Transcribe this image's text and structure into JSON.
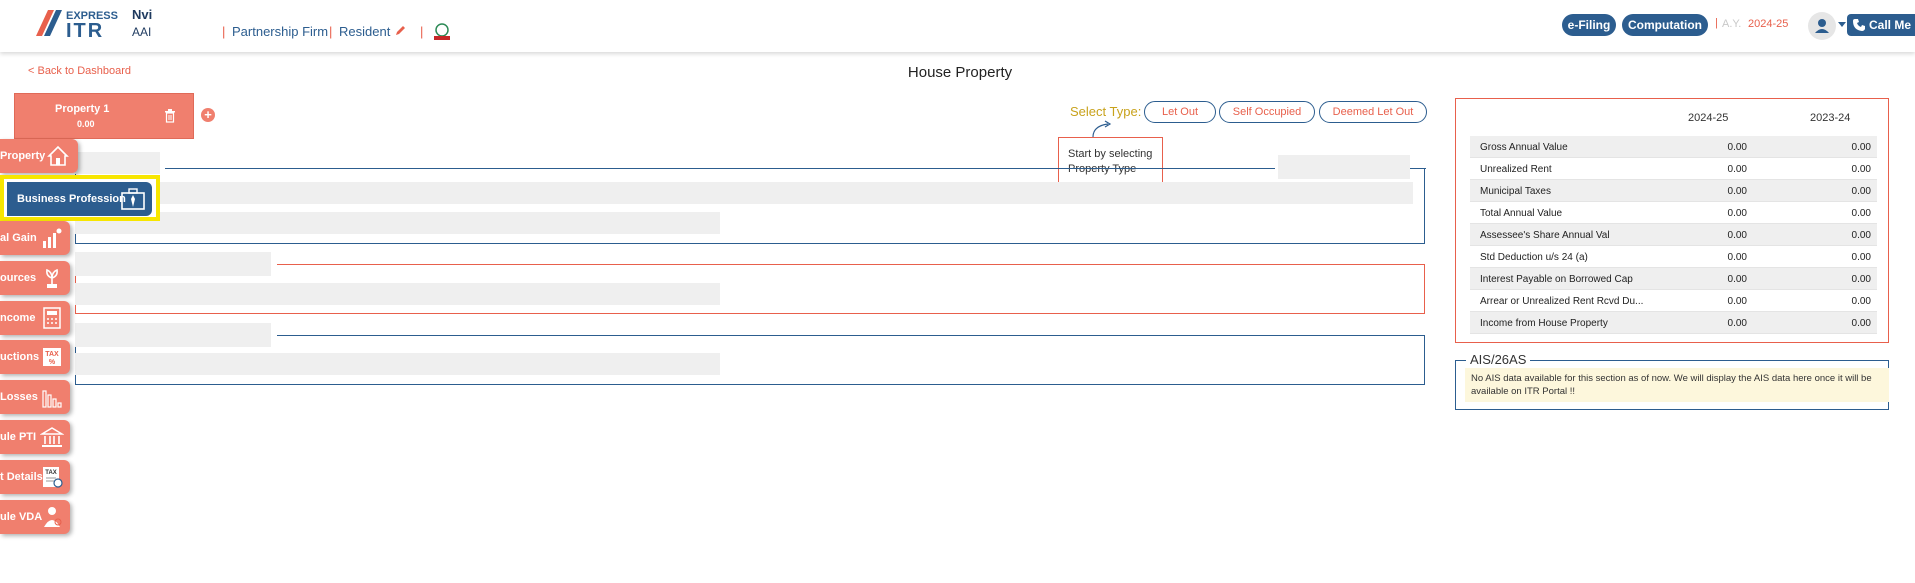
{
  "header": {
    "logo_top": "EXPRESS",
    "logo_main": "ITR",
    "user_name": "Nvi",
    "user_pan": "AAI",
    "status_type": "Partnership Firm",
    "residency": "Resident",
    "efiling_label": "e-Filing",
    "computation_label": "Computation",
    "ay_label": "A.Y.",
    "ay_value": "2024-25",
    "callme_label": "Call Me"
  },
  "nav": {
    "back_label": "< Back to Dashboard",
    "page_title": "House Property"
  },
  "property_tab": {
    "name": "Property 1",
    "amount": "0.00",
    "add_label": "+"
  },
  "type_selector": {
    "label": "Select Type:",
    "options": [
      "Let Out",
      "Self Occupied",
      "Deemed Let Out"
    ],
    "tooltip": "Start by selecting Property Type"
  },
  "sidebar": {
    "items": [
      {
        "label": "Property",
        "icon": "house-icon"
      },
      {
        "label": "Business Profession",
        "icon": "briefcase-icon",
        "highlighted": true
      },
      {
        "label": "al Gain",
        "icon": "chart-growth-icon"
      },
      {
        "label": "ources",
        "icon": "plant-icon"
      },
      {
        "label": "ncome",
        "icon": "calculator-icon"
      },
      {
        "label": "uctions",
        "icon": "tax-percent-icon"
      },
      {
        "label": "Losses",
        "icon": "loss-chart-icon"
      },
      {
        "label": "ule PTI",
        "icon": "bank-icon"
      },
      {
        "label": "t Details",
        "icon": "tax-doc-icon"
      },
      {
        "label": "ule VDA",
        "icon": "crypto-user-icon"
      }
    ]
  },
  "summary": {
    "years": [
      "2024-25",
      "2023-24"
    ],
    "rows": [
      {
        "name": "Gross Annual Value",
        "v1": "0.00",
        "v2": "0.00"
      },
      {
        "name": "Unrealized Rent",
        "v1": "0.00",
        "v2": "0.00"
      },
      {
        "name": "Municipal Taxes",
        "v1": "0.00",
        "v2": "0.00"
      },
      {
        "name": "Total Annual Value",
        "v1": "0.00",
        "v2": "0.00"
      },
      {
        "name": "Assessee's Share Annual Val",
        "v1": "0.00",
        "v2": "0.00"
      },
      {
        "name": "Std Deduction u/s 24 (a)",
        "v1": "0.00",
        "v2": "0.00"
      },
      {
        "name": "Interest Payable on Borrowed Cap",
        "v1": "0.00",
        "v2": "0.00"
      },
      {
        "name": "Arrear or Unrealized Rent Rcvd Du...",
        "v1": "0.00",
        "v2": "0.00"
      },
      {
        "name": "Income from House Property",
        "v1": "0.00",
        "v2": "0.00"
      }
    ]
  },
  "ais": {
    "title": "AIS/26AS",
    "message": "No AIS data available for this section as of now. We will display the AIS data here once it will be available on ITR Portal !!"
  },
  "colors": {
    "brand_blue": "#2c5d8f",
    "brand_coral": "#f07f6e",
    "accent_orange": "#e8604c",
    "highlight_yellow": "#f7e600"
  }
}
